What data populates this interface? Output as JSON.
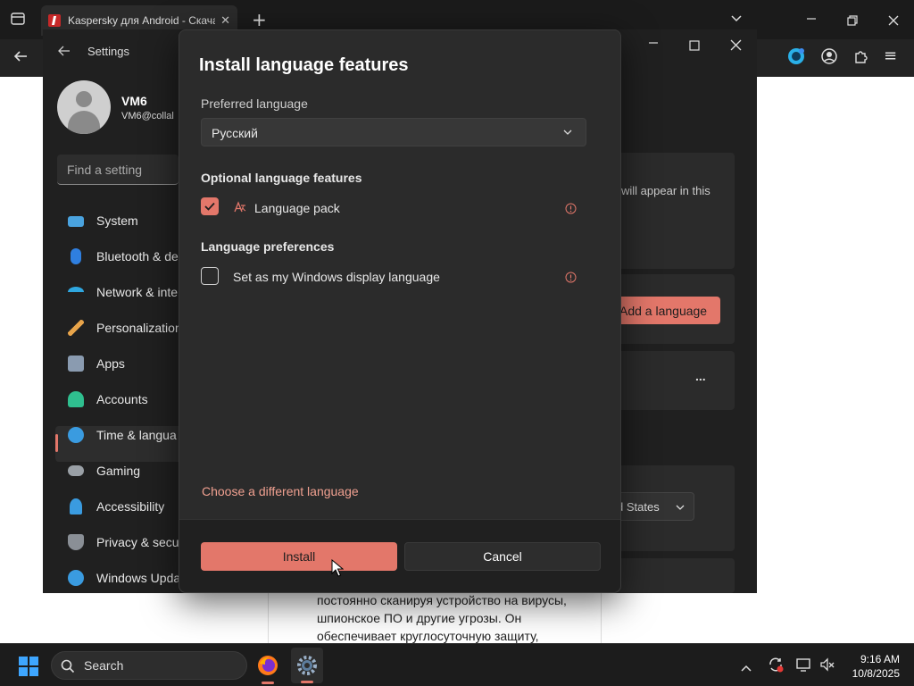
{
  "browser": {
    "tab_title": "Kaspersky для Android - Скача",
    "tab_close": "✕",
    "new_tab": "+",
    "menu_icon": "≡"
  },
  "webpage": {
    "lines": [
      "постоянно сканируя устройство на вирусы,",
      "шпионское ПО и другие угрозы. Он",
      "обеспечивает круглосуточную защиту,"
    ]
  },
  "settings": {
    "title": "Settings",
    "user_name": "VM6",
    "user_email": "VM6@collal",
    "search_placeholder": "Find a setting",
    "nav": [
      {
        "label": "System",
        "color": "#4aa3df"
      },
      {
        "label": "Bluetooth & de",
        "color": "#2f7fe0"
      },
      {
        "label": "Network & inte",
        "color": "#2fa7e0"
      },
      {
        "label": "Personalization",
        "color": "#e8a44a"
      },
      {
        "label": "Apps",
        "color": "#8a9bb0"
      },
      {
        "label": "Accounts",
        "color": "#2fbf8f"
      },
      {
        "label": "Time & langua",
        "color": "#3a9be0"
      },
      {
        "label": "Gaming",
        "color": "#9aa0a6"
      },
      {
        "label": "Accessibility",
        "color": "#3a9be0"
      },
      {
        "label": "Privacy & secur",
        "color": "#8a8f96"
      },
      {
        "label": "Windows Upda",
        "color": "#3a9be0"
      }
    ],
    "right_text_1": "will appear in this",
    "add_language": "Add a language",
    "region": "d States",
    "more": "..."
  },
  "dialog": {
    "title": "Install language features",
    "preferred_label": "Preferred language",
    "language_value": "Русский",
    "optional_heading": "Optional language features",
    "language_pack": "Language pack",
    "preferences_heading": "Language preferences",
    "display_language": "Set as my Windows display language",
    "different_link": "Choose a different language",
    "install": "Install",
    "cancel": "Cancel",
    "language_pack_checked": true,
    "display_language_checked": false
  },
  "taskbar": {
    "search": "Search",
    "time": "9:16 AM",
    "date": "10/8/2025"
  },
  "colors": {
    "accent": "#e3776a",
    "link": "#f0a090"
  }
}
